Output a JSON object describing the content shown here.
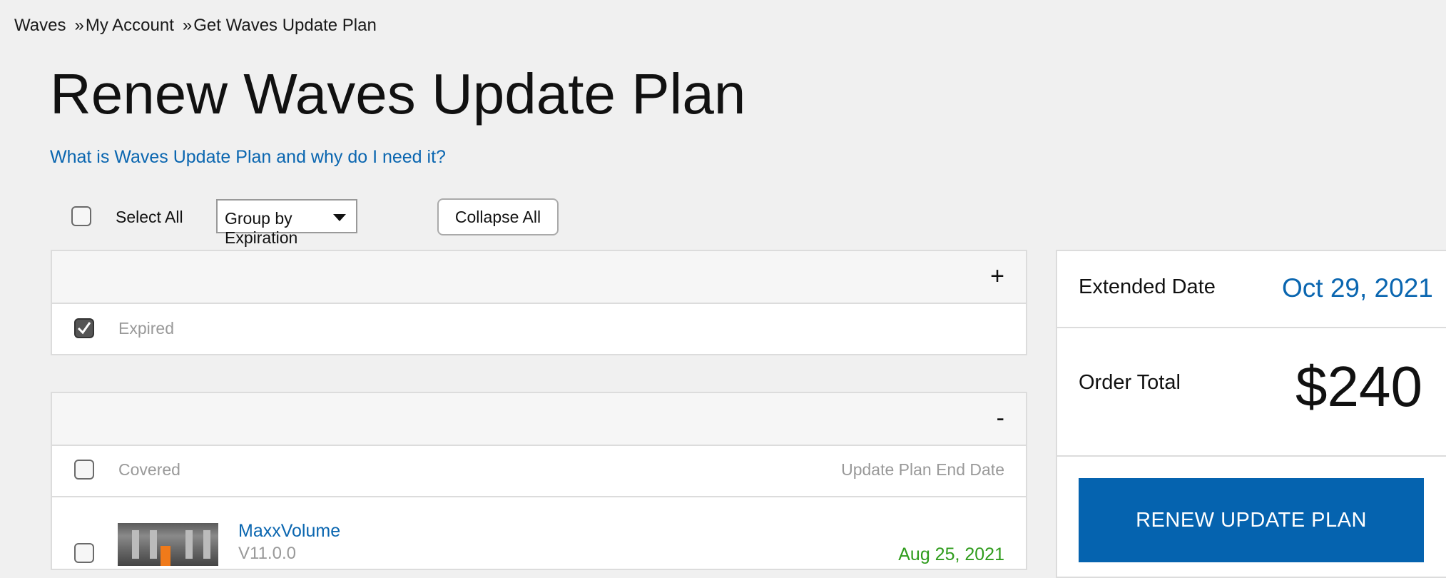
{
  "breadcrumb": {
    "items": [
      "Waves",
      "My Account",
      "Get Waves Update Plan"
    ],
    "separator": "»"
  },
  "page": {
    "title": "Renew Waves Update Plan",
    "help_link": "What is Waves Update Plan and why do I need it?"
  },
  "toolbar": {
    "select_all_label": "Select All",
    "select_all_checked": false,
    "group_by_value": "Group by Expiration",
    "collapse_label": "Collapse All"
  },
  "groups": [
    {
      "toggle": "+",
      "header_label": "Expired",
      "header_checked": true
    },
    {
      "toggle": "-",
      "header_label": "Covered",
      "header_checked": false,
      "date_column_label": "Update Plan End Date",
      "products": [
        {
          "name": "MaxxVolume",
          "version": "V11.0.0",
          "end_date": "Aug 25, 2021",
          "checked": false
        }
      ]
    }
  ],
  "summary": {
    "extended_date_label": "Extended Date",
    "extended_date_value": "Oct 29, 2021",
    "order_total_label": "Order Total",
    "order_total_value": "$240",
    "renew_button_label": "RENEW UPDATE PLAN"
  },
  "colors": {
    "link": "#0a66b0",
    "primary_button": "#0563af",
    "date_green": "#2f9c1c",
    "page_background": "#f0f0f0"
  }
}
